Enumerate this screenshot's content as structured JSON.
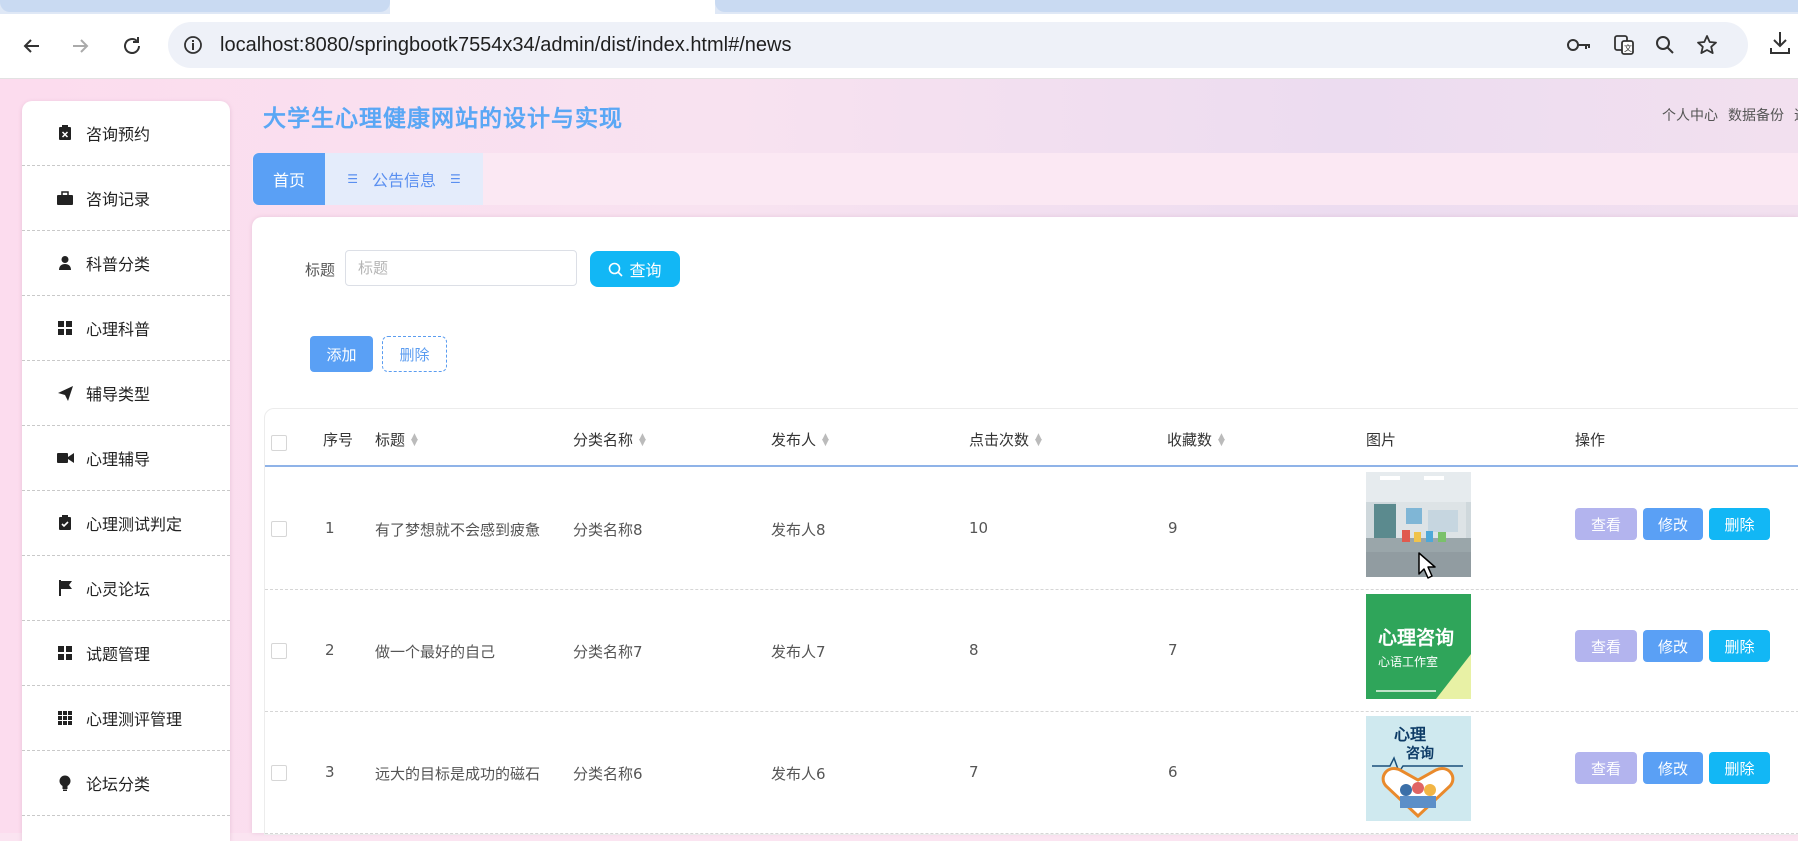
{
  "browser": {
    "url": "localhost:8080/springbootk7554x34/admin/dist/index.html#/news"
  },
  "app": {
    "title": "大学生心理健康网站的设计与实现",
    "top_links": [
      "个人中心",
      "数据备份",
      "退"
    ]
  },
  "sidebar": {
    "items": [
      {
        "label": "咨询预约",
        "icon": "clipboard-x-icon"
      },
      {
        "label": "咨询记录",
        "icon": "briefcase-icon"
      },
      {
        "label": "科普分类",
        "icon": "user-icon"
      },
      {
        "label": "心理科普",
        "icon": "grid-icon"
      },
      {
        "label": "辅导类型",
        "icon": "paper-plane-icon"
      },
      {
        "label": "心理辅导",
        "icon": "video-camera-icon"
      },
      {
        "label": "心理测试判定",
        "icon": "clipboard-check-icon"
      },
      {
        "label": "心灵论坛",
        "icon": "flag-icon"
      },
      {
        "label": "试题管理",
        "icon": "grid-icon"
      },
      {
        "label": "心理测评管理",
        "icon": "grid-3x3-icon"
      },
      {
        "label": "论坛分类",
        "icon": "lightbulb-icon"
      }
    ]
  },
  "tabs": {
    "home": "首页",
    "news": "公告信息"
  },
  "search": {
    "label": "标题",
    "placeholder": "标题",
    "query_button": "查询"
  },
  "actions": {
    "add": "添加",
    "delete": "删除"
  },
  "table": {
    "columns": [
      "序号",
      "标题",
      "分类名称",
      "发布人",
      "点击次数",
      "收藏数",
      "图片",
      "操作"
    ],
    "rows": [
      {
        "index": "1",
        "title": "有了梦想就不会感到疲惫",
        "category": "分类名称8",
        "publisher": "发布人8",
        "clicks": "10",
        "favorites": "9",
        "image": "room-photo"
      },
      {
        "index": "2",
        "title": "做一个最好的自己",
        "category": "分类名称7",
        "publisher": "发布人7",
        "clicks": "8",
        "favorites": "7",
        "image": "consult-poster",
        "image_text": [
          "心理咨询",
          "心语工作室"
        ]
      },
      {
        "index": "3",
        "title": "远大的目标是成功的磁石",
        "category": "分类名称6",
        "publisher": "发布人6",
        "clicks": "7",
        "favorites": "6",
        "image": "heart-hands-poster",
        "image_text": [
          "心理",
          "咨询"
        ]
      }
    ],
    "row_buttons": {
      "view": "查看",
      "edit": "修改",
      "delete": "删除"
    }
  },
  "colors": {
    "title_blue": "#5aa7f5",
    "primary": "#5aa0f5",
    "query_cyan": "#12b7f5",
    "view_lavender": "#b3b4ee"
  }
}
